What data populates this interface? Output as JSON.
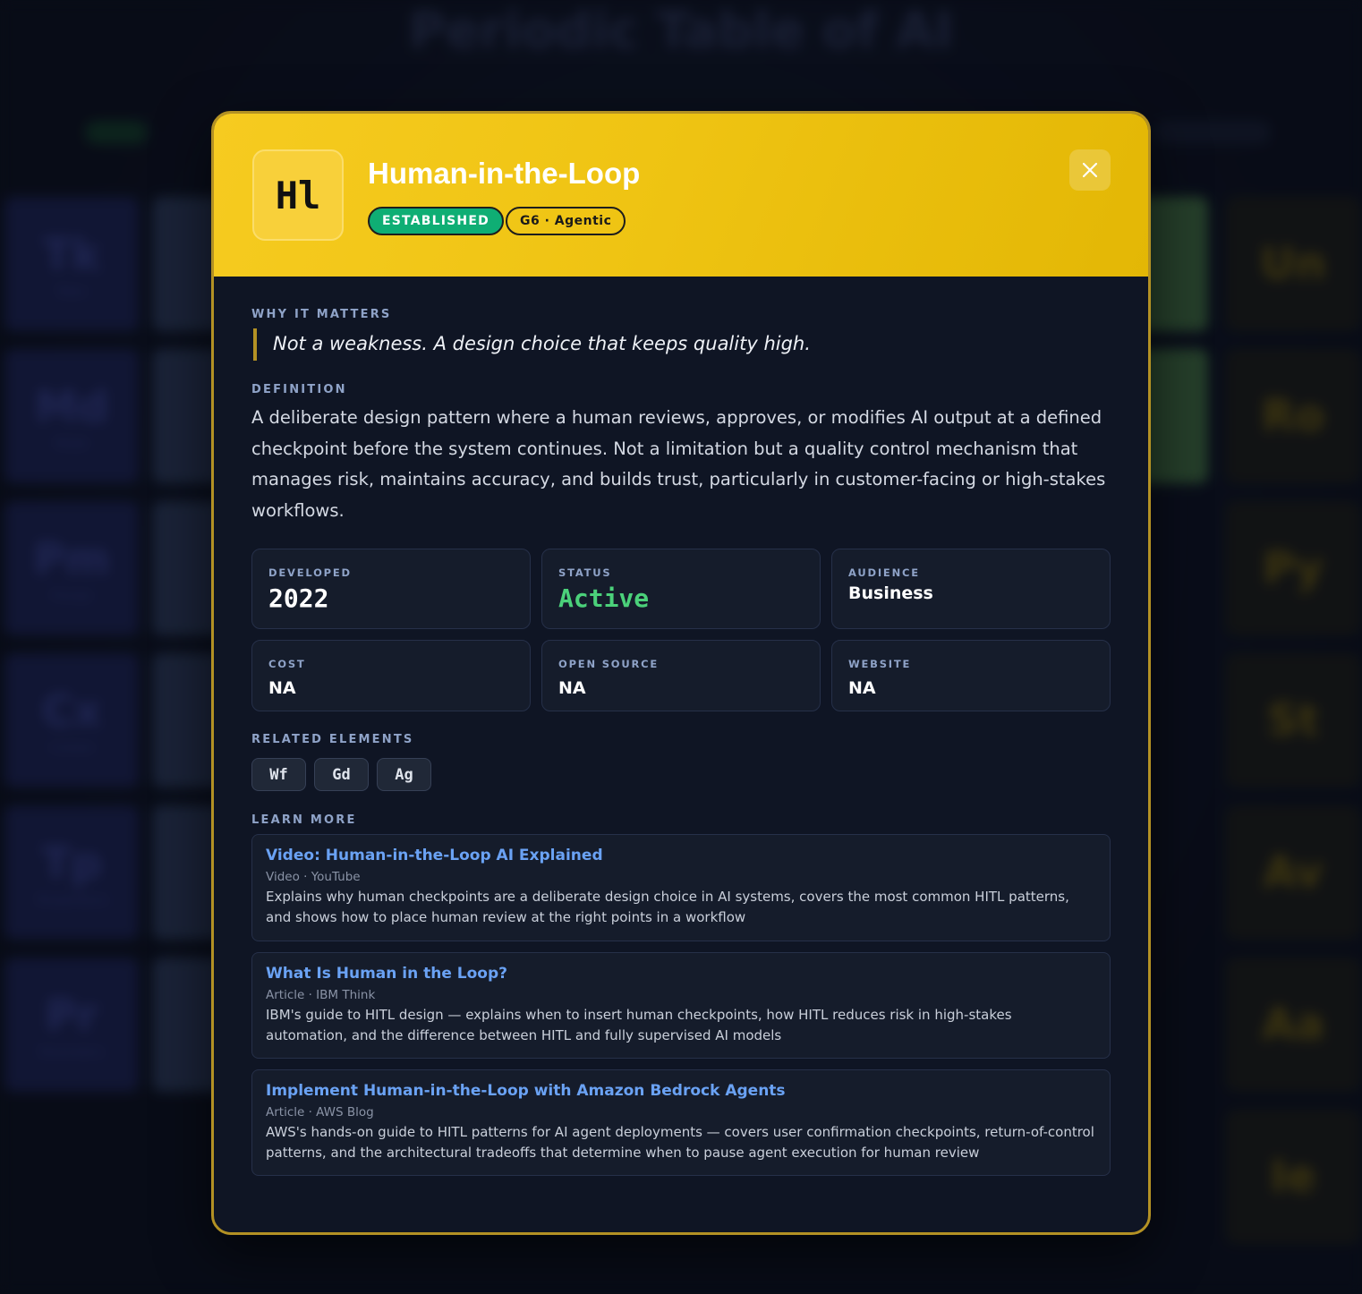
{
  "background": {
    "title": "Periodic Table of AI",
    "tiles": [
      {
        "symbol": "Tk",
        "name": "Token",
        "tone": "blue"
      },
      {
        "symbol": "Md",
        "name": "Model",
        "tone": "blue"
      },
      {
        "symbol": "Pm",
        "name": "Prompt",
        "tone": "blue"
      },
      {
        "symbol": "Cx",
        "name": "Context",
        "tone": "blue"
      },
      {
        "symbol": "Tp",
        "name": "Temperature",
        "tone": "blue"
      },
      {
        "symbol": "Pr",
        "name": "Parameters",
        "tone": "blue"
      },
      {
        "symbol": "Un",
        "name": "",
        "tone": "gold"
      },
      {
        "symbol": "Ro",
        "name": "",
        "tone": "gold"
      },
      {
        "symbol": "Py",
        "name": "",
        "tone": "gold"
      },
      {
        "symbol": "St",
        "name": "",
        "tone": "gold"
      },
      {
        "symbol": "Av",
        "name": "",
        "tone": "gold"
      },
      {
        "symbol": "Aa",
        "name": "",
        "tone": "gold"
      },
      {
        "symbol": "Ie",
        "name": "",
        "tone": "gold"
      }
    ]
  },
  "element": {
    "symbol": "Hl",
    "name": "Human-in-the-Loop",
    "maturity_badge": "ESTABLISHED",
    "group_badge": "G6 · Agentic",
    "accent_color": "#f2c617",
    "badge_color": "#0fae74"
  },
  "close_icon": "close-icon",
  "why": {
    "label": "WHY IT MATTERS",
    "quote": "Not a weakness. A design choice that keeps quality high."
  },
  "definition": {
    "label": "DEFINITION",
    "text": "A deliberate design pattern where a human reviews, approves, or modifies AI output at a defined checkpoint before the system continues. Not a limitation but a quality control mechanism that manages risk, maintains accuracy, and builds trust, particularly in customer-facing or high-stakes workflows."
  },
  "stats": {
    "developed": {
      "label": "DEVELOPED",
      "value": "2022"
    },
    "status": {
      "label": "STATUS",
      "value": "Active",
      "color": "#4bd17a"
    },
    "audience": {
      "label": "AUDIENCE",
      "value": "Business"
    },
    "cost": {
      "label": "COST",
      "value": "NA"
    },
    "open_source": {
      "label": "OPEN SOURCE",
      "value": "NA"
    },
    "website": {
      "label": "WEBSITE",
      "value": "NA"
    }
  },
  "related": {
    "label": "RELATED ELEMENTS",
    "items": [
      "Wf",
      "Gd",
      "Ag"
    ]
  },
  "learn_more": {
    "label": "LEARN MORE",
    "resources": [
      {
        "title": "Video: Human-in-the-Loop AI Explained",
        "meta": "Video · YouTube",
        "description": "Explains why human checkpoints are a deliberate design choice in AI systems, covers the most common HITL patterns, and shows how to place human review at the right points in a workflow"
      },
      {
        "title": "What Is Human in the Loop?",
        "meta": "Article · IBM Think",
        "description": "IBM's guide to HITL design — explains when to insert human checkpoints, how HITL reduces risk in high-stakes automation, and the difference between HITL and fully supervised AI models"
      },
      {
        "title": "Implement Human-in-the-Loop with Amazon Bedrock Agents",
        "meta": "Article · AWS Blog",
        "description": "AWS's hands-on guide to HITL patterns for AI agent deployments — covers user confirmation checkpoints, return-of-control patterns, and the architectural tradeoffs that determine when to pause agent execution for human review"
      }
    ]
  }
}
